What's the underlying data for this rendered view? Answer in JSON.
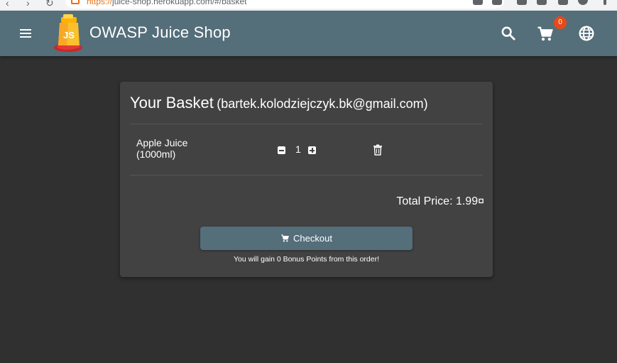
{
  "browser": {
    "url_scheme": "https://",
    "url_rest": "juice-shop.herokuapp.com/#/basket"
  },
  "toolbar": {
    "title": "OWASP Juice Shop",
    "cart_count": "0",
    "icons": [
      "menu-icon",
      "juice-shop-logo",
      "search-icon",
      "cart-icon",
      "language-icon"
    ]
  },
  "basket": {
    "title": "Your Basket",
    "email": "(bartek.kolodziejczyk.bk@gmail.com)",
    "items": [
      {
        "name": "Apple Juice (1000ml)",
        "quantity": "1"
      }
    ],
    "total_label": "Total Price: 1.99¤",
    "checkout_label": "Checkout",
    "bonus_text": "You will gain 0 Bonus Points from this order!"
  },
  "colors": {
    "background": "#303030",
    "toolbar": "#546e7a",
    "card": "#424242",
    "badge": "#e64a19"
  }
}
